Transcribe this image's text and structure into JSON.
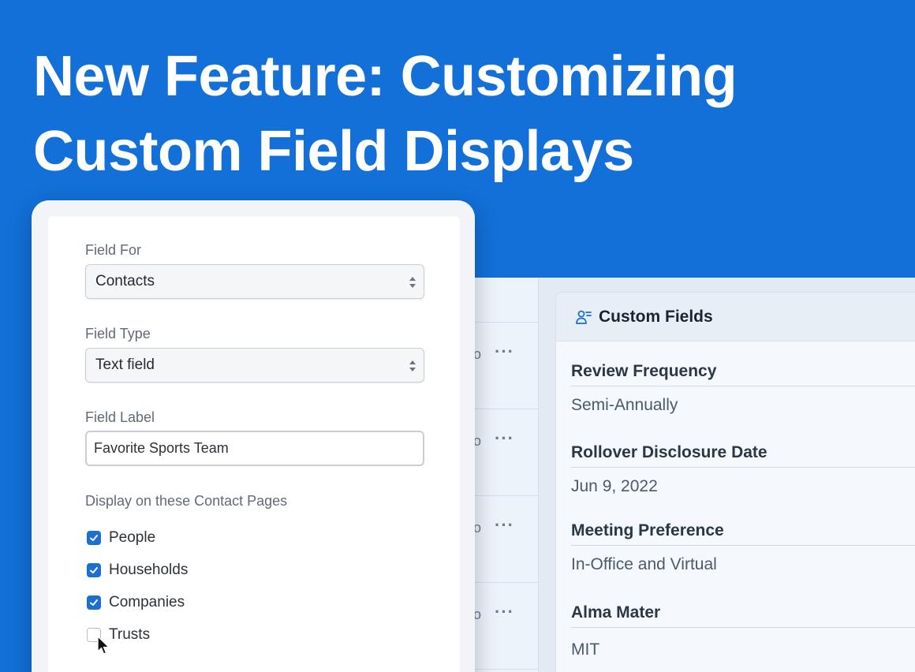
{
  "headline": {
    "line1": "New Feature: Customizing",
    "line2": "Custom Field Displays"
  },
  "form": {
    "field_for": {
      "label": "Field For",
      "value": "Contacts"
    },
    "field_type": {
      "label": "Field Type",
      "value": "Text field"
    },
    "field_label": {
      "label": "Field Label",
      "value": "Favorite Sports Team"
    },
    "display_pages": {
      "label": "Display on these Contact Pages",
      "options": [
        {
          "label": "People",
          "checked": true
        },
        {
          "label": "Households",
          "checked": true
        },
        {
          "label": "Companies",
          "checked": true
        },
        {
          "label": "Trusts",
          "checked": false
        }
      ]
    }
  },
  "list_rows": [
    {
      "fragment": "o",
      "menu": "···"
    },
    {
      "fragment": "o",
      "menu": "···"
    },
    {
      "fragment": "o",
      "menu": "···"
    },
    {
      "fragment": "o",
      "menu": "···"
    }
  ],
  "custom_fields": {
    "title": "Custom Fields",
    "fields": [
      {
        "label": "Review Frequency",
        "value": "Semi-Annually"
      },
      {
        "label": "Rollover Disclosure Date",
        "value": "Jun 9, 2022"
      },
      {
        "label": "Meeting Preference",
        "value": "In-Office and Virtual"
      },
      {
        "label": "Alma Mater",
        "value": "MIT"
      }
    ]
  },
  "colors": {
    "brand_blue": "#1270d8",
    "checkbox_blue": "#1b6fd4"
  },
  "icons": {
    "custom_fields_header": "user-list-icon",
    "select_arrows": "sort-arrows-icon",
    "checkmark": "check-icon",
    "pointer": "mouse-cursor-icon"
  }
}
